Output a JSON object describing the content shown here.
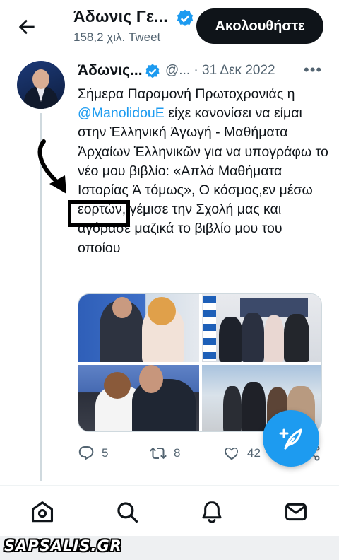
{
  "header": {
    "name": "Άδωνις Γε...",
    "tweet_count": "158,2 χιλ. Tweet",
    "follow_label": "Ακολουθήστε"
  },
  "tweet": {
    "author_name": "Άδωνις...",
    "handle_date": "@... · 31 Δεκ 2022",
    "more_label": "•••",
    "text_before_mention": "Σήμερα Παραμονή Πρωτοχρονιάς η ",
    "mention": "@ManolidouE",
    "text_after_mention": " είχε κανονίσει να είμαι στην Ἑλληνική Ἀγωγή - Μαθήματα Ἀρχαίων Ἑλληνικῶν για να υπογράφω το νέο μου βιβλίο: «Απλά Μαθήματα Ιστορίας Ἀ τόμως», Ο κόσμος,εν μέσω εορτών, γέμισε την Σχολή μας και αγόρασε μαζικά το βιβλίο μου του οποίου",
    "reply_count": "5",
    "retweet_count": "8",
    "like_count": "42"
  },
  "watermark": "SAPSALIS.GR",
  "colors": {
    "accent": "#1d9bf0",
    "text": "#0f1419",
    "muted": "#536471"
  }
}
